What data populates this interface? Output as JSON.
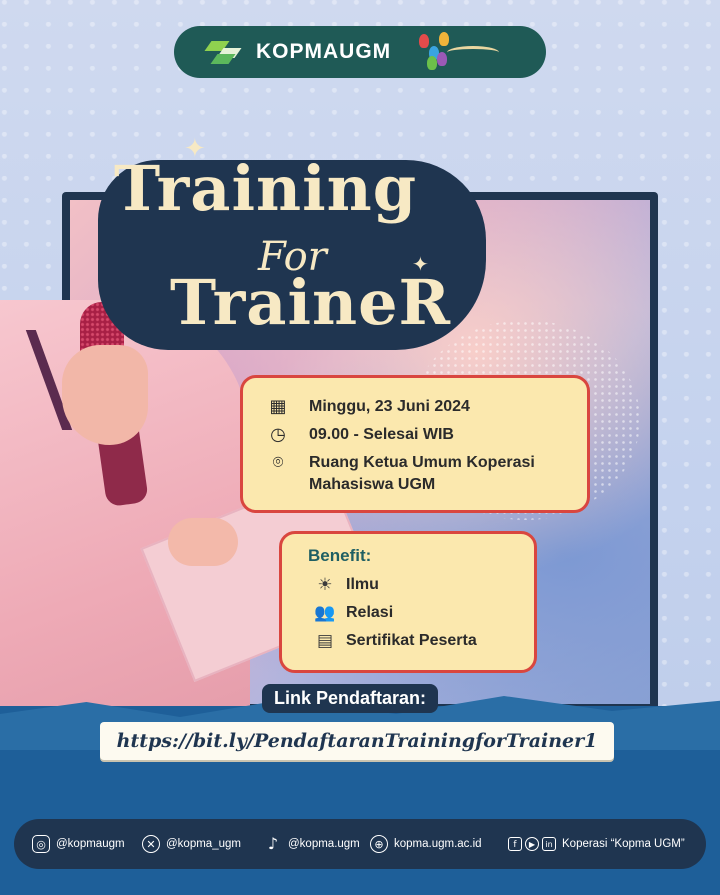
{
  "header": {
    "brand": "KOPMAUGM",
    "logo_icon": "kopma-logo-icon",
    "partner_logo_icon": "hands-logo-icon"
  },
  "title": {
    "line1": "Training",
    "line2": "For",
    "line3": "TraineR"
  },
  "event": {
    "date": "Minggu, 23 Juni 2024",
    "time": "09.00 - Selesai WIB",
    "location_line1": "Ruang Ketua Umum Koperasi",
    "location_line2": "Mahasiswa UGM",
    "icons": [
      "calendar-icon",
      "clock-icon",
      "location-pin-icon"
    ]
  },
  "benefit": {
    "title": "Benefit:",
    "items": [
      {
        "label": "Ilmu",
        "icon": "lightbulb-icon"
      },
      {
        "label": "Relasi",
        "icon": "people-icon"
      },
      {
        "label": "Sertifikat Peserta",
        "icon": "certificate-icon"
      }
    ]
  },
  "registration": {
    "label": "Link Pendaftaran:",
    "url": "https://bit.ly/PendaftaranTrainingforTrainer1"
  },
  "footer": {
    "instagram": "@kopmaugm",
    "x": "@kopma_ugm",
    "tiktok": "@kopma.ugm",
    "website": "kopma.ugm.ac.id",
    "social_name": "Koperasi “Kopma UGM”"
  },
  "colors": {
    "navy": "#1f3550",
    "teal": "#1f5a56",
    "cream": "#fbe8ae",
    "red_border": "#d9463f",
    "wave_blue": "#1e5f99"
  }
}
